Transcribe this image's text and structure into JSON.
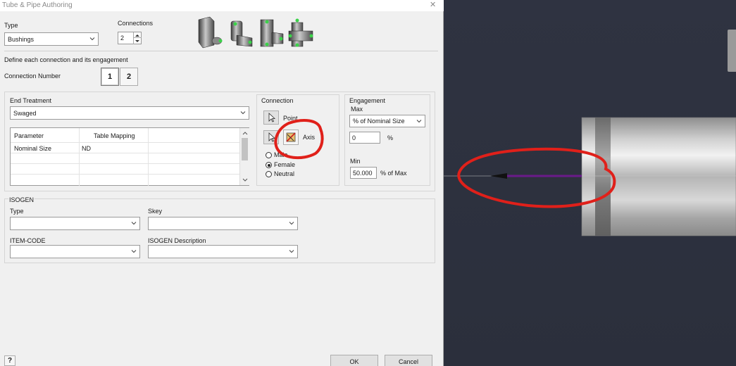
{
  "window": {
    "title": "Tube & Pipe Authoring",
    "close_glyph": "✕"
  },
  "type_section": {
    "type_label": "Type",
    "type_value": "Bushings",
    "connections_label": "Connections",
    "connections_value": "2"
  },
  "define_text": "Define each connection and its engagement",
  "connection_number": {
    "label": "Connection Number",
    "buttons": [
      "1",
      "2"
    ],
    "active": "1"
  },
  "end_treatment": {
    "label": "End Treatment",
    "value": "Swaged",
    "table": {
      "headers": [
        "Parameter",
        "Table Mapping"
      ],
      "rows": [
        [
          "Nominal Size",
          "ND"
        ]
      ]
    }
  },
  "connection": {
    "label": "Connection",
    "point_label": "Point",
    "axis_label": "Axis",
    "radios": [
      "Male",
      "Female",
      "Neutral"
    ],
    "selected": "Female"
  },
  "engagement": {
    "label": "Engagement",
    "max_label": "Max",
    "max_mode": "% of Nominal Size",
    "max_value": "0",
    "max_unit": "%",
    "min_label": "Min",
    "min_value": "50.000",
    "min_unit": "% of Max"
  },
  "isogen": {
    "label": "ISOGEN",
    "type_label": "Type",
    "skey_label": "Skey",
    "item_code_label": "ITEM-CODE",
    "description_label": "ISOGEN Description"
  },
  "footer": {
    "help_glyph": "?",
    "ok_label": "OK",
    "cancel_label": "Cancel"
  },
  "colors": {
    "annotation": "#e0201a",
    "axis_line": "#6a1a8a",
    "accent_green": "#3cd24a"
  }
}
